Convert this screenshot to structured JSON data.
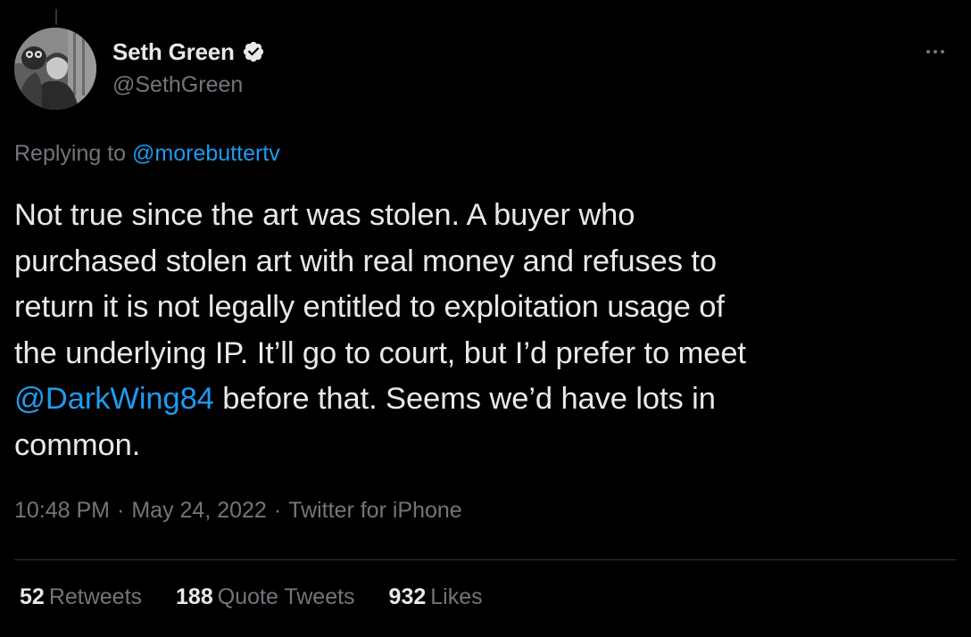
{
  "author": {
    "display_name": "Seth Green",
    "handle": "@SethGreen",
    "verified": true,
    "avatar_icon": "profile-photo"
  },
  "reply": {
    "prefix": "Replying to",
    "mention": "@morebuttertv"
  },
  "tweet": {
    "lines": [
      "Not true since the art was stolen. A buyer who",
      "purchased stolen art with real money and refuses to",
      "return it is not legally entitled to exploitation usage of",
      "the underlying IP. It’ll go to court, but I’d prefer to meet"
    ],
    "mention": "@DarkWing84",
    "line5_rest": " before that. Seems we’d have lots in",
    "line6": "common."
  },
  "meta": {
    "time": "10:48 PM",
    "separator": "·",
    "date": "May 24, 2022",
    "source": "Twitter for iPhone"
  },
  "stats": {
    "retweets": {
      "count": "52",
      "label": "Retweets"
    },
    "quote_tweets": {
      "count": "188",
      "label": "Quote Tweets"
    },
    "likes": {
      "count": "932",
      "label": "Likes"
    }
  },
  "icons": {
    "verified": "verified-badge-icon",
    "more": "more-options-icon"
  },
  "colors": {
    "background": "#000000",
    "text": "#e7e9ea",
    "secondary": "#71767b",
    "link": "#1d9bf0",
    "divider": "#2f3336"
  }
}
